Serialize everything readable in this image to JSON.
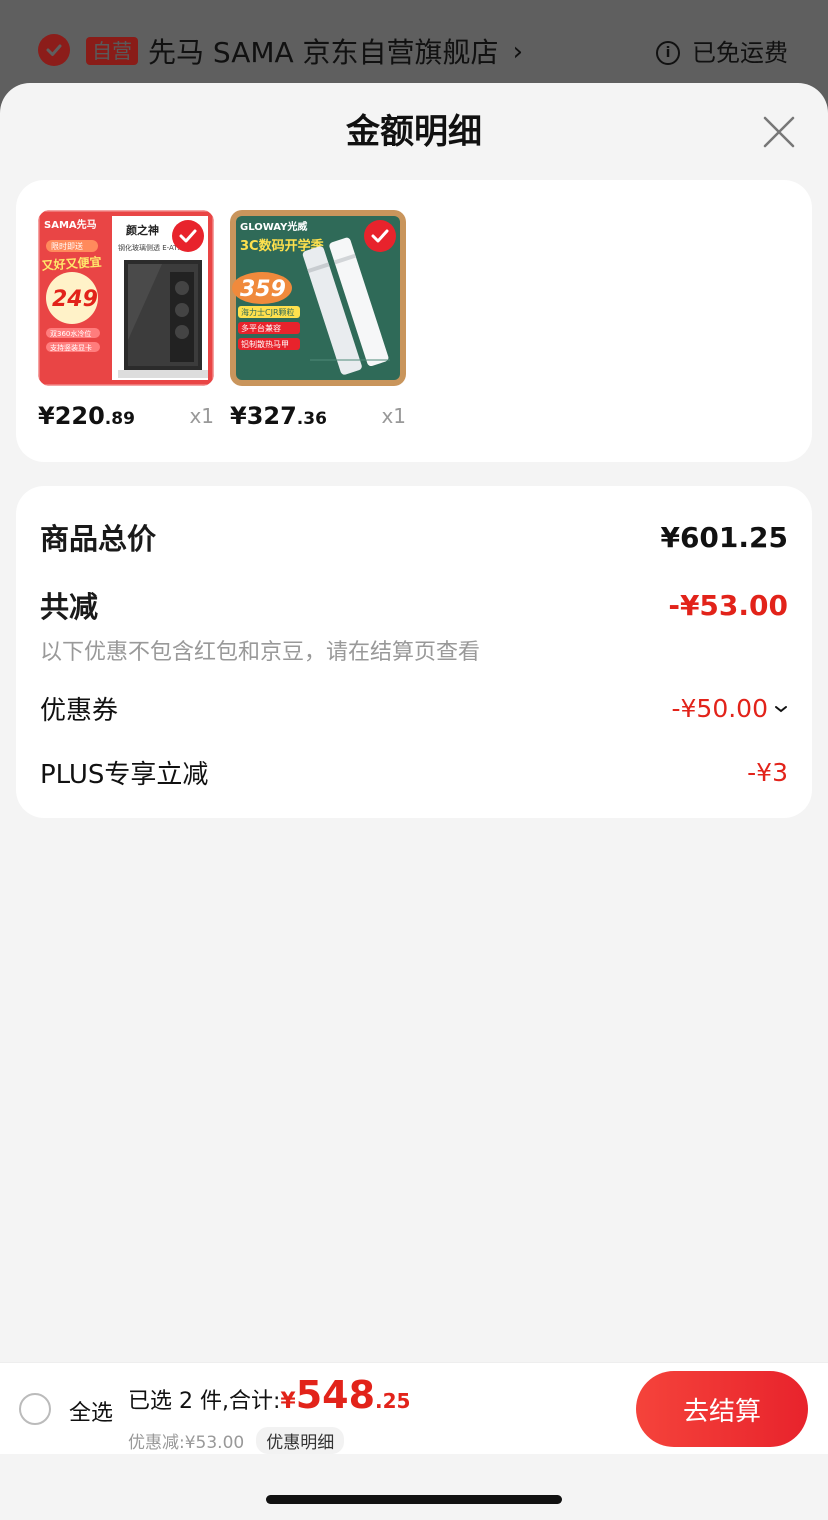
{
  "store": {
    "badge": "自营",
    "name": "先马 SAMA 京东自营旗舰店",
    "shipping": "已免运费"
  },
  "sheet": {
    "title": "金额明细"
  },
  "products": [
    {
      "brand": "SAMA先马",
      "promo_tag": "限时即送",
      "headline": "又好又便宜",
      "price_in_image": "249",
      "product_title": "颜之神",
      "product_sub": "钢化玻璃侧透 E-ATX",
      "features": [
        "双360水冷位",
        "支持竖装显卡"
      ],
      "price_int": "¥220",
      "price_dec": ".89",
      "qty": "x1"
    },
    {
      "brand": "GLOWAY光威",
      "headline": "3C数码开学季",
      "price_in_image": "359",
      "features": [
        "海力士CJR颗粒",
        "多平台兼容",
        "铝制散热马甲"
      ],
      "price_int": "¥327",
      "price_dec": ".36",
      "qty": "x1"
    }
  ],
  "summary": {
    "total_label": "商品总价",
    "total_value": "¥601.25",
    "reduce_label": "共减",
    "reduce_value": "-¥53.00",
    "reduce_note": "以下优惠不包含红包和京豆，请在结算页查看",
    "coupon_label": "优惠券",
    "coupon_value": "-¥50.00",
    "plus_label": "PLUS专享立减",
    "plus_value": "-¥3"
  },
  "bottom": {
    "select_all": "全选",
    "selected_text": "已选 2 件,合计:",
    "currency": "¥",
    "amount_int": "548",
    "amount_dec": ".25",
    "discount_text": "优惠减:¥53.00",
    "detail_chip": "优惠明细",
    "checkout": "去结算"
  },
  "colors": {
    "accent": "#e2231a",
    "checkout_gradient": [
      "#f5433b",
      "#e8232c"
    ]
  }
}
